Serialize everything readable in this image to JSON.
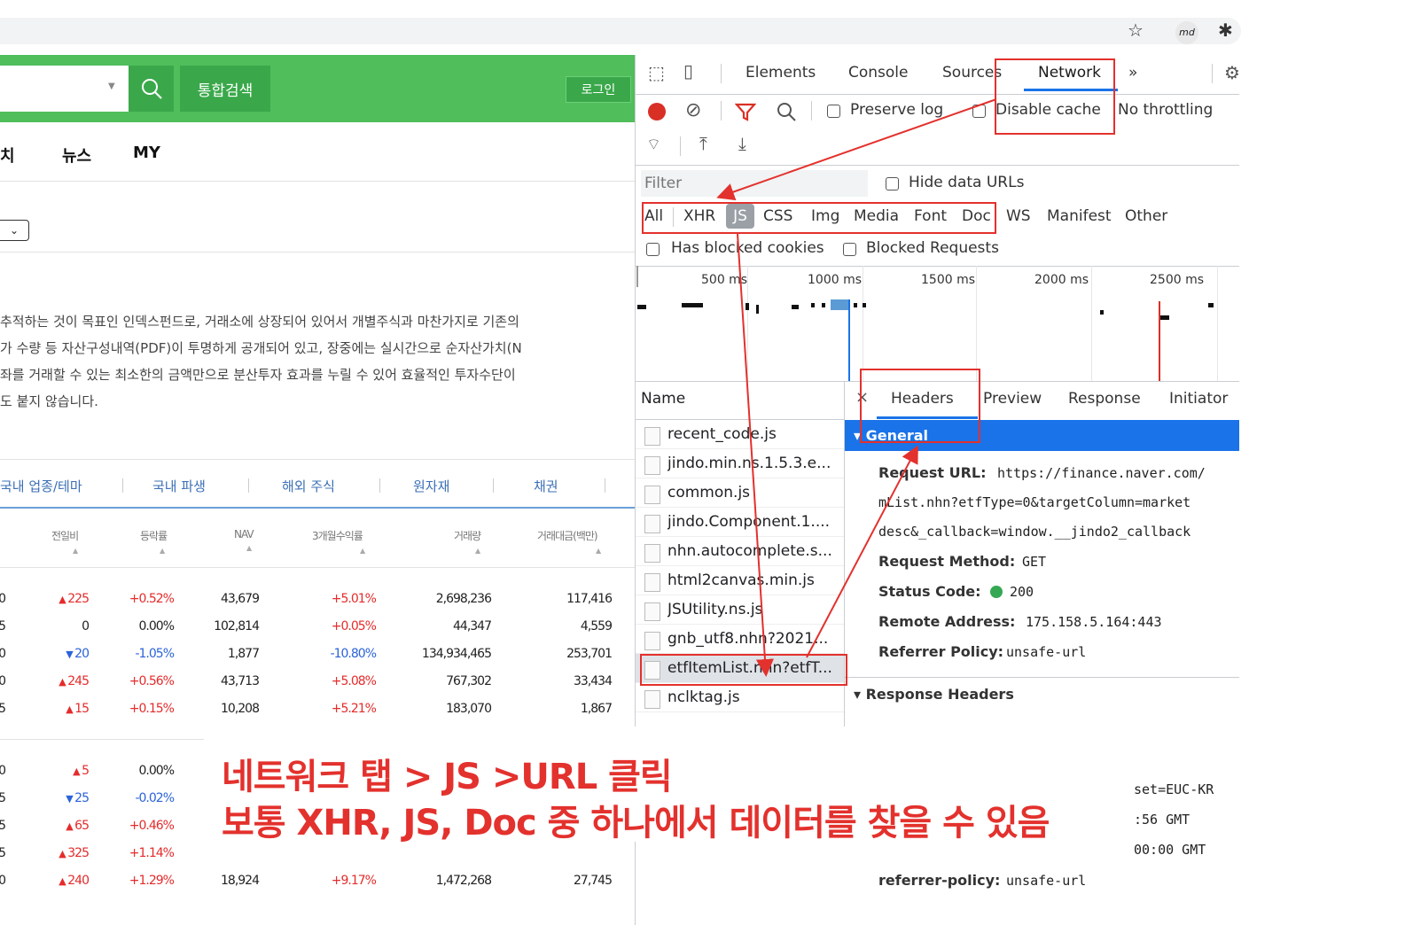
{
  "browser": {
    "profile_badge": "md"
  },
  "page": {
    "search_button_label": "통합검색",
    "login_label": "로그인",
    "nav": [
      "치",
      "뉴스",
      "MY"
    ],
    "description_lines": [
      "추적하는 것이 목표인 인덱스펀드로, 거래소에 상장되어 있어서 개별주식과 마찬가지로 기존의",
      "가 수량 등 자산구성내역(PDF)이 투명하게 공개되어 있고, 장중에는 실시간으로 순자산가치(N",
      "좌를 거래할 수 있는 최소한의 금액만으로 분산투자 효과를 누릴 수 있어 효율적인 투자수단이",
      "도 붙지 않습니다."
    ],
    "category_tabs": [
      "국내 업종/테마",
      "국내 파생",
      "해외 주식",
      "원자재",
      "채권"
    ],
    "columns": [
      "전일비",
      "등락률",
      "NAV",
      "3개월수익률",
      "거래량",
      "거래대금(백만)"
    ],
    "rows": [
      {
        "lead": "0",
        "change": "225",
        "dir": "up",
        "rate": "+0.52%",
        "nav": "43,679",
        "ret3m": "+5.01%",
        "volume": "2,698,236",
        "amount": "117,416"
      },
      {
        "lead": "5",
        "change": "0",
        "dir": "flat",
        "rate": "0.00%",
        "nav": "102,814",
        "ret3m": "+0.05%",
        "volume": "44,347",
        "amount": "4,559"
      },
      {
        "lead": "0",
        "change": "20",
        "dir": "down",
        "rate": "-1.05%",
        "nav": "1,877",
        "ret3m": "-10.80%",
        "volume": "134,934,465",
        "amount": "253,701"
      },
      {
        "lead": "0",
        "change": "245",
        "dir": "up",
        "rate": "+0.56%",
        "nav": "43,713",
        "ret3m": "+5.08%",
        "volume": "767,302",
        "amount": "33,434"
      },
      {
        "lead": "5",
        "change": "15",
        "dir": "up",
        "rate": "+0.15%",
        "nav": "10,208",
        "ret3m": "+5.21%",
        "volume": "183,070",
        "amount": "1,867"
      }
    ],
    "rows2": [
      {
        "lead": "0",
        "change": "5",
        "dir": "up",
        "rate": "0.00%"
      },
      {
        "lead": "5",
        "change": "25",
        "dir": "down",
        "rate": "-0.02%"
      },
      {
        "lead": "5",
        "change": "65",
        "dir": "up",
        "rate": "+0.46%"
      },
      {
        "lead": "5",
        "change": "325",
        "dir": "up",
        "rate": "+1.14%"
      },
      {
        "lead": "0",
        "change": "240",
        "dir": "up",
        "rate": "+1.29%",
        "nav": "18,924",
        "ret3m": "+9.17%",
        "volume": "1,472,268",
        "amount": "27,745"
      }
    ]
  },
  "devtools": {
    "tabs": [
      "Elements",
      "Console",
      "Sources",
      "Network"
    ],
    "more": "»",
    "preserve_log": "Preserve log",
    "disable_cache": "Disable cache",
    "throttling": "No throttling",
    "filter_placeholder": "Filter",
    "hide_data_urls": "Hide data URLs",
    "types": [
      "All",
      "XHR",
      "JS",
      "CSS",
      "Img",
      "Media",
      "Font",
      "Doc",
      "WS",
      "Manifest",
      "Other"
    ],
    "has_blocked_cookies": "Has blocked cookies",
    "blocked_requests": "Blocked Requests",
    "timeline_labels": [
      "500 ms",
      "1000 ms",
      "1500 ms",
      "2000 ms",
      "2500 ms"
    ],
    "name_header": "Name",
    "files": [
      "recent_code.js",
      "jindo.min.ns.1.5.3.e...",
      "common.js",
      "jindo.Component.1....",
      "nhn.autocomplete.s...",
      "html2canvas.min.js",
      "JSUtility.ns.js",
      "gnb_utf8.nhn?2021...",
      "etfItemList.nhn?etfT...",
      "nclktag.js"
    ],
    "detail_tabs": [
      "Headers",
      "Preview",
      "Response",
      "Initiator"
    ],
    "close": "×",
    "general_title": "▾ General",
    "request_url_label": "Request URL:",
    "request_url_lines": [
      "https://finance.naver.com/",
      "mList.nhn?etfType=0&targetColumn=market",
      "desc&_callback=window.__jindo2_callback"
    ],
    "request_method_label": "Request Method:",
    "request_method": "GET",
    "status_code_label": "Status Code:",
    "status_code": "200",
    "remote_address_label": "Remote Address:",
    "remote_address": "175.158.5.164:443",
    "referrer_policy_label": "Referrer Policy:",
    "referrer_policy": "unsafe-url",
    "response_headers_title": "▾ Response Headers",
    "resp_fragments": [
      "set=EUC-KR",
      ":56 GMT",
      "00:00 GMT"
    ],
    "resp_referrer_label": "referrer-policy:",
    "resp_referrer_value": "unsafe-url"
  },
  "annotation": {
    "line1": "네트워크 탭 > JS >URL 클릭",
    "line2": "보통 XHR, JS, Doc 중 하나에서 데이터를 찾을 수 있음",
    "color": "#e3312d"
  }
}
